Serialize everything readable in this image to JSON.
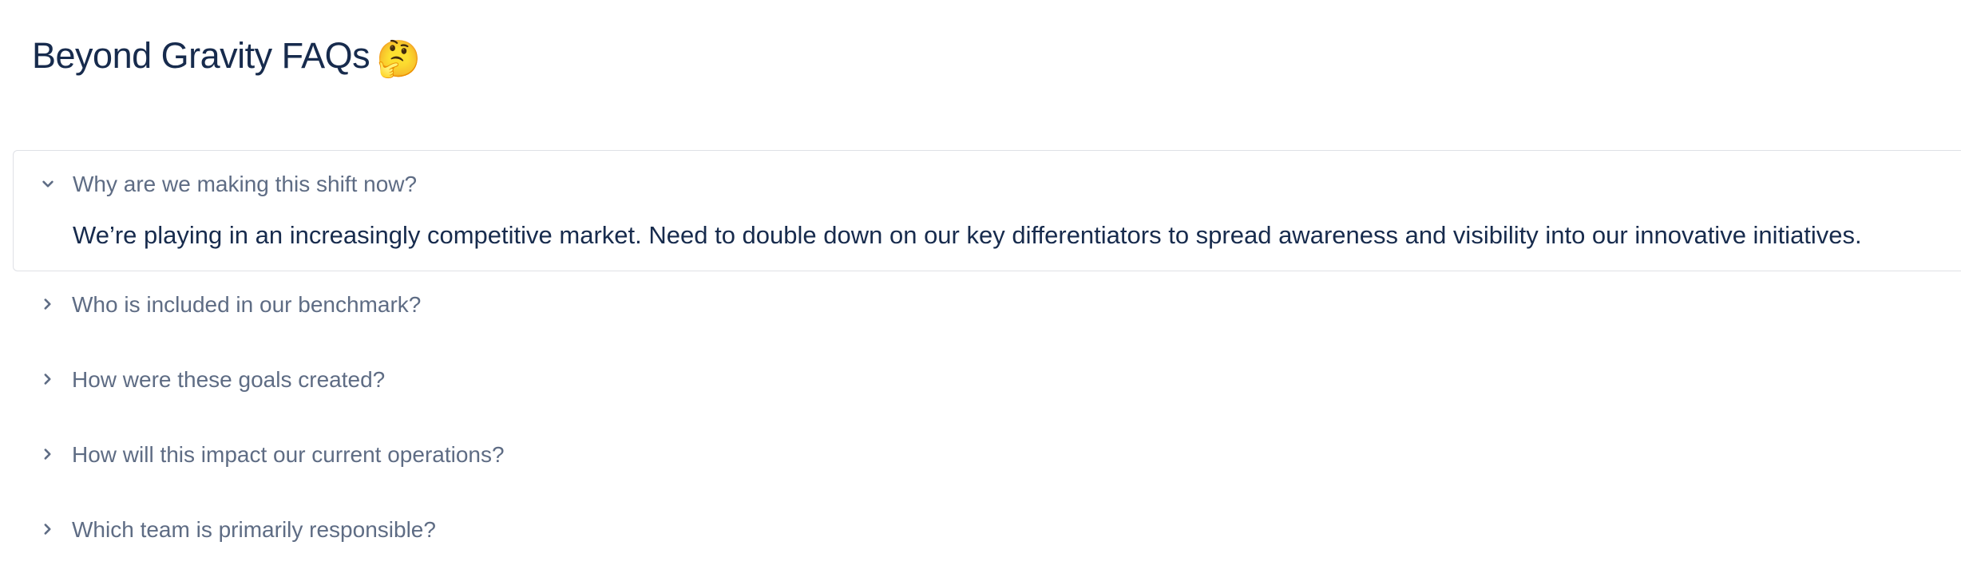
{
  "page": {
    "title": "Beyond Gravity FAQs",
    "title_emoji": "🤔"
  },
  "colors": {
    "title": "#172b4d",
    "question": "#5e6c84",
    "answer": "#172b4d",
    "border": "#dfe1e6"
  },
  "faq": {
    "items": [
      {
        "question": "Why are we making this shift now?",
        "expanded": true,
        "answer": "We’re playing in an increasingly competitive market. Need to double down on our key differentiators to spread awareness and visibility into our innovative initiatives.",
        "icon": "chevron-down-icon"
      },
      {
        "question": "Who is included in our benchmark?",
        "expanded": false,
        "icon": "chevron-right-icon"
      },
      {
        "question": "How were these goals created?",
        "expanded": false,
        "icon": "chevron-right-icon"
      },
      {
        "question": "How will this impact our current operations?",
        "expanded": false,
        "icon": "chevron-right-icon"
      },
      {
        "question": "Which team is primarily responsible?",
        "expanded": false,
        "icon": "chevron-right-icon"
      }
    ]
  }
}
